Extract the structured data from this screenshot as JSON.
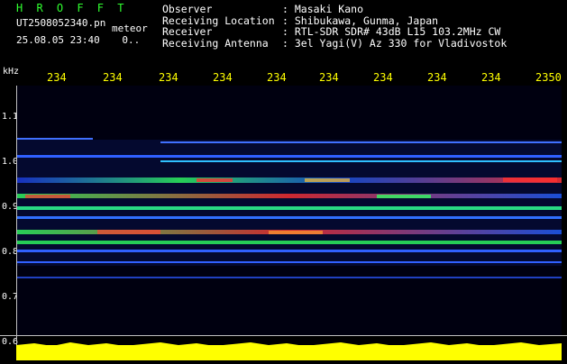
{
  "header": {
    "brand": "H R O F F T",
    "filename": "UT2508052340.pn",
    "meteor_label": "meteor",
    "datetime": "25.08.05 23:40",
    "count": "0..",
    "info": {
      "labels": [
        "Observer",
        "Receiving Location",
        "Receiver",
        "Receiving Antenna"
      ],
      "values": [
        ": Masaki Kano",
        ": Shibukawa, Gunma, Japan",
        ": RTL-SDR SDR# 43dB L15 103.2MHz CW",
        ": 3el Yagi(V) Az 330 for Vladivostok"
      ]
    }
  },
  "axes": {
    "y_unit": "kHz",
    "x_ticks": [
      "234",
      "234",
      "234",
      "234",
      "234",
      "234",
      "234",
      "234",
      "234",
      "2350"
    ],
    "y_ticks": [
      "1.1",
      "1.0",
      "0.9",
      "0.8",
      "0.7",
      "0.6"
    ]
  },
  "colors": {
    "brand": "#30ff30",
    "x_ticks": "#ffff00",
    "text": "#ffffff",
    "background": "#000000",
    "plot_background": "#000010",
    "signal_strong": "#ff3030",
    "signal_mid": "#30ff60",
    "signal_weak": "#3060ff",
    "audio_bar": "#ffff00"
  }
}
